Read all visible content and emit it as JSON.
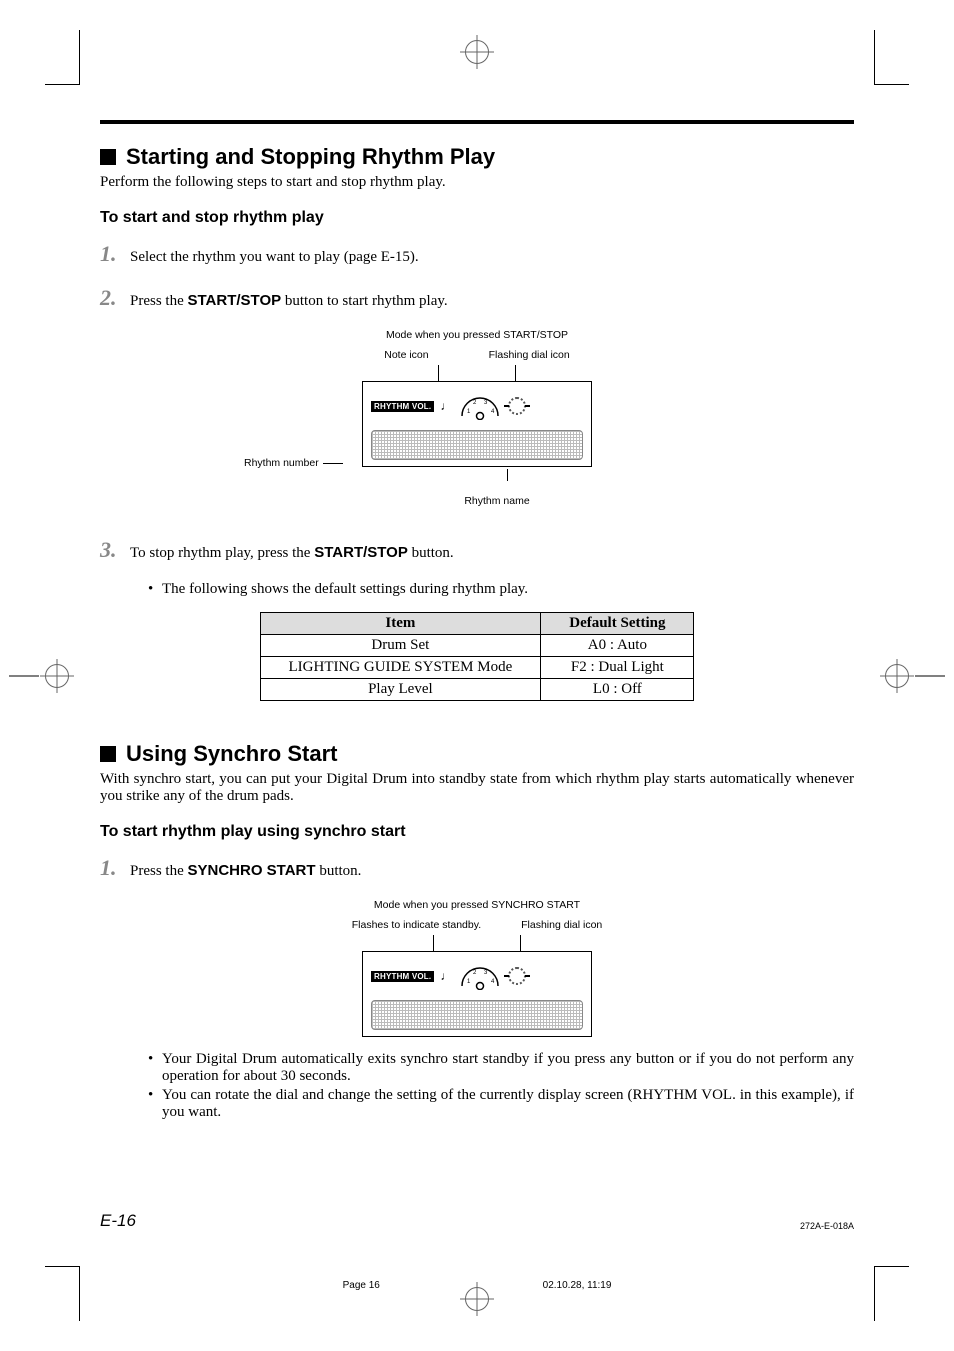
{
  "section1": {
    "heading": "Starting and Stopping Rhythm Play",
    "intro": "Perform the following steps to start and stop rhythm play.",
    "subheading": "To start and stop rhythm play",
    "step1": "Select the rhythm you want to play (page E-15).",
    "step2_pre": "Press the ",
    "step2_btn": "START/STOP",
    "step2_post": " button to start rhythm play.",
    "step3_pre": "To stop rhythm play, press the ",
    "step3_btn": "START/STOP",
    "step3_post": " button.",
    "step3_bullet": "The following shows the default settings during rhythm play."
  },
  "fig1": {
    "caption": "Mode when you pressed START/STOP",
    "label_note": "Note icon",
    "label_dial": "Flashing dial icon",
    "label_rnum": "Rhythm number",
    "label_rname": "Rhythm name",
    "rvol": "RHYTHM VOL."
  },
  "table": {
    "h1": "Item",
    "h2": "Default Setting",
    "r1c1": "Drum Set",
    "r1c2": "A0 : Auto",
    "r2c1": "LIGHTING GUIDE SYSTEM Mode",
    "r2c2": "F2 : Dual Light",
    "r3c1": "Play Level",
    "r3c2": "L0 : Off"
  },
  "section2": {
    "heading": "Using Synchro Start",
    "intro": "With synchro start, you can put your Digital Drum into standby state from which rhythm play starts automatically whenever you strike any of the drum pads.",
    "subheading": "To start rhythm play using synchro start",
    "step1_pre": "Press the ",
    "step1_btn": "SYNCHRO START",
    "step1_post": " button.",
    "bullet1": "Your Digital Drum automatically exits synchro start standby if you press any button or if you do not perform any operation for about 30 seconds.",
    "bullet2": "You can rotate the dial and change the setting of the currently display screen (RHYTHM VOL. in this example), if you want."
  },
  "fig2": {
    "caption": "Mode when you pressed SYNCHRO START",
    "label_flash": "Flashes to indicate standby.",
    "label_dial": "Flashing dial icon",
    "rvol": "RHYTHM VOL."
  },
  "footer": {
    "page": "E-16",
    "docid": "272A-E-018A",
    "imprint_page": "Page 16",
    "imprint_date": "02.10.28, 11:19"
  }
}
